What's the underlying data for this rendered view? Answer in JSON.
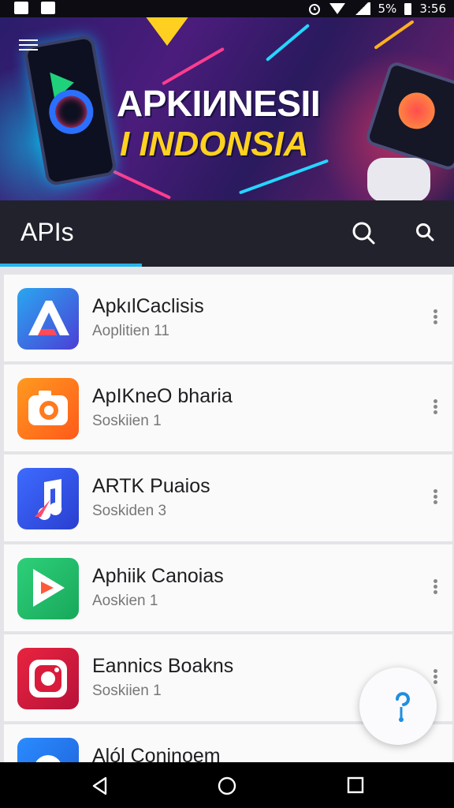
{
  "status_bar": {
    "battery_text": "5%",
    "time": "3:56",
    "icons": [
      "notification-icon",
      "notification-icon-2",
      "alarm-icon",
      "wifi-icon",
      "signal-icon",
      "battery-icon"
    ]
  },
  "banner": {
    "title_line1": "APKIИNESII",
    "title_line2": "I INDONSIA",
    "colors": {
      "title_primary": "#ffffff",
      "title_accent": "#ffd21f"
    }
  },
  "app_bar": {
    "title": "APIs",
    "active_tab_color": "#25b5ee"
  },
  "apps": [
    {
      "name": "ApkılCaclisis",
      "subtitle": "Aoplitien 11",
      "icon": "letter-a-app-icon"
    },
    {
      "name": "ApIKneO bharia",
      "subtitle": "Soskiien 1",
      "icon": "camera-app-icon"
    },
    {
      "name": "ARTK Puaios",
      "subtitle": "Soskiden 3",
      "icon": "music-note-app-icon"
    },
    {
      "name": "Aphiik  Canoias",
      "subtitle": "Aoskien 1",
      "icon": "play-arrow-app-icon"
    },
    {
      "name": "Eannics Boakns",
      "subtitle": "Soskiien 1",
      "icon": "instagram-app-icon"
    },
    {
      "name": "Alól Coninoem",
      "subtitle": "",
      "icon": "camera-lens-app-icon"
    }
  ],
  "fab": {
    "icon": "assistant-icon"
  },
  "nav_bar": {
    "icons": [
      "back-icon",
      "home-icon",
      "recents-icon"
    ]
  }
}
